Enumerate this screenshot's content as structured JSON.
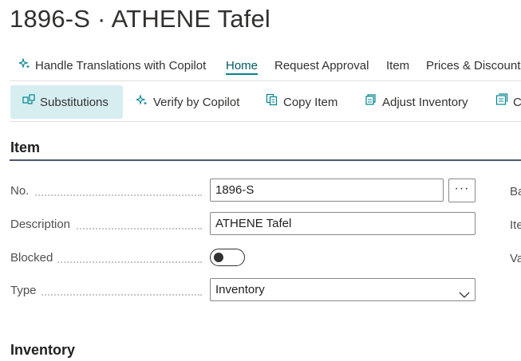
{
  "page": {
    "title": "1896-S · ATHENE Tafel"
  },
  "action_bar": {
    "items": [
      {
        "label": "Handle Translations with Copilot",
        "icon": "copilot-sparkle-icon"
      },
      {
        "label": "Home",
        "active": true
      },
      {
        "label": "Request Approval"
      },
      {
        "label": "Item"
      },
      {
        "label": "Prices & Discounts"
      }
    ]
  },
  "promoted": {
    "items": [
      {
        "label": "Substitutions",
        "icon": "substitutions-icon",
        "selected": true
      },
      {
        "label": "Verify by Copilot",
        "icon": "copilot-sparkle-icon"
      },
      {
        "label": "Copy Item",
        "icon": "copy-icon"
      },
      {
        "label": "Adjust Inventory",
        "icon": "adjust-inventory-icon"
      },
      {
        "label": "C",
        "icon": "card-icon"
      }
    ]
  },
  "item_section": {
    "title": "Item",
    "fields": {
      "no": {
        "label": "No.",
        "value": "1896-S",
        "button": "···"
      },
      "description": {
        "label": "Description",
        "value": "ATHENE Tafel"
      },
      "blocked": {
        "label": "Blocked",
        "value": false
      },
      "type": {
        "label": "Type",
        "value": "Inventory"
      }
    },
    "right_column_labels": [
      "Ba",
      "Ite",
      "Va"
    ]
  },
  "inventory_section": {
    "title": "Inventory"
  },
  "colors": {
    "accent": "#00848e",
    "selected_bg": "#d7eef1"
  }
}
